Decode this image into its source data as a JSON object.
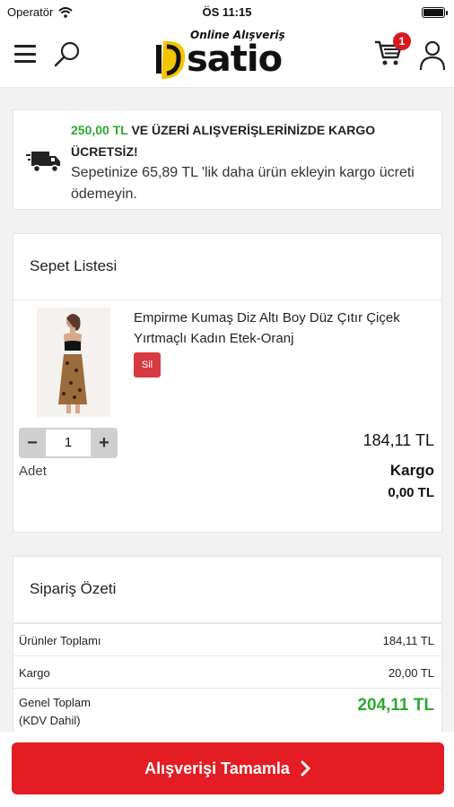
{
  "status_bar": {
    "carrier": "Operatör",
    "time": "ÖS 11:15"
  },
  "header": {
    "logo_tagline": "Online Alışveriş",
    "logo_word": "satio",
    "cart_count": "1",
    "icons": [
      "menu-icon",
      "search-icon",
      "cart-icon",
      "user-icon"
    ]
  },
  "shipping_notice": {
    "threshold": "250,00 TL",
    "headline": " VE ÜZERİ ALIŞVERİŞLERİNİZDE KARGO ÜCRETSİZ!",
    "message": "Sepetinize 65,89 TL 'lik daha ürün ekleyin kargo ücreti ödemeyin."
  },
  "basket": {
    "title": "Sepet Listesi",
    "item": {
      "name": "Empirme Kumaş Diz Altı Boy Düz Çıtır Çiçek Yırtmaçlı Kadın Etek-Oranj",
      "delete_label": "Sil",
      "quantity": "1",
      "quantity_label": "Adet",
      "price": "184,11 TL",
      "shipping_label": "Kargo",
      "shipping_value": "0,00 TL"
    }
  },
  "summary": {
    "title": "Sipariş Özeti",
    "rows": [
      {
        "label": "Ürünler Toplamı",
        "value": "184,11 TL"
      },
      {
        "label": "Kargo",
        "value": "20,00 TL"
      }
    ],
    "total_label_1": "Genel Toplam",
    "total_label_2": "(KDV Dahil)",
    "total_value": "204,11 TL"
  },
  "checkout": {
    "label": "Alışverişi Tamamla"
  },
  "colors": {
    "accent": "#e41c23",
    "green": "#2ea82e",
    "badge": "#d71920"
  }
}
